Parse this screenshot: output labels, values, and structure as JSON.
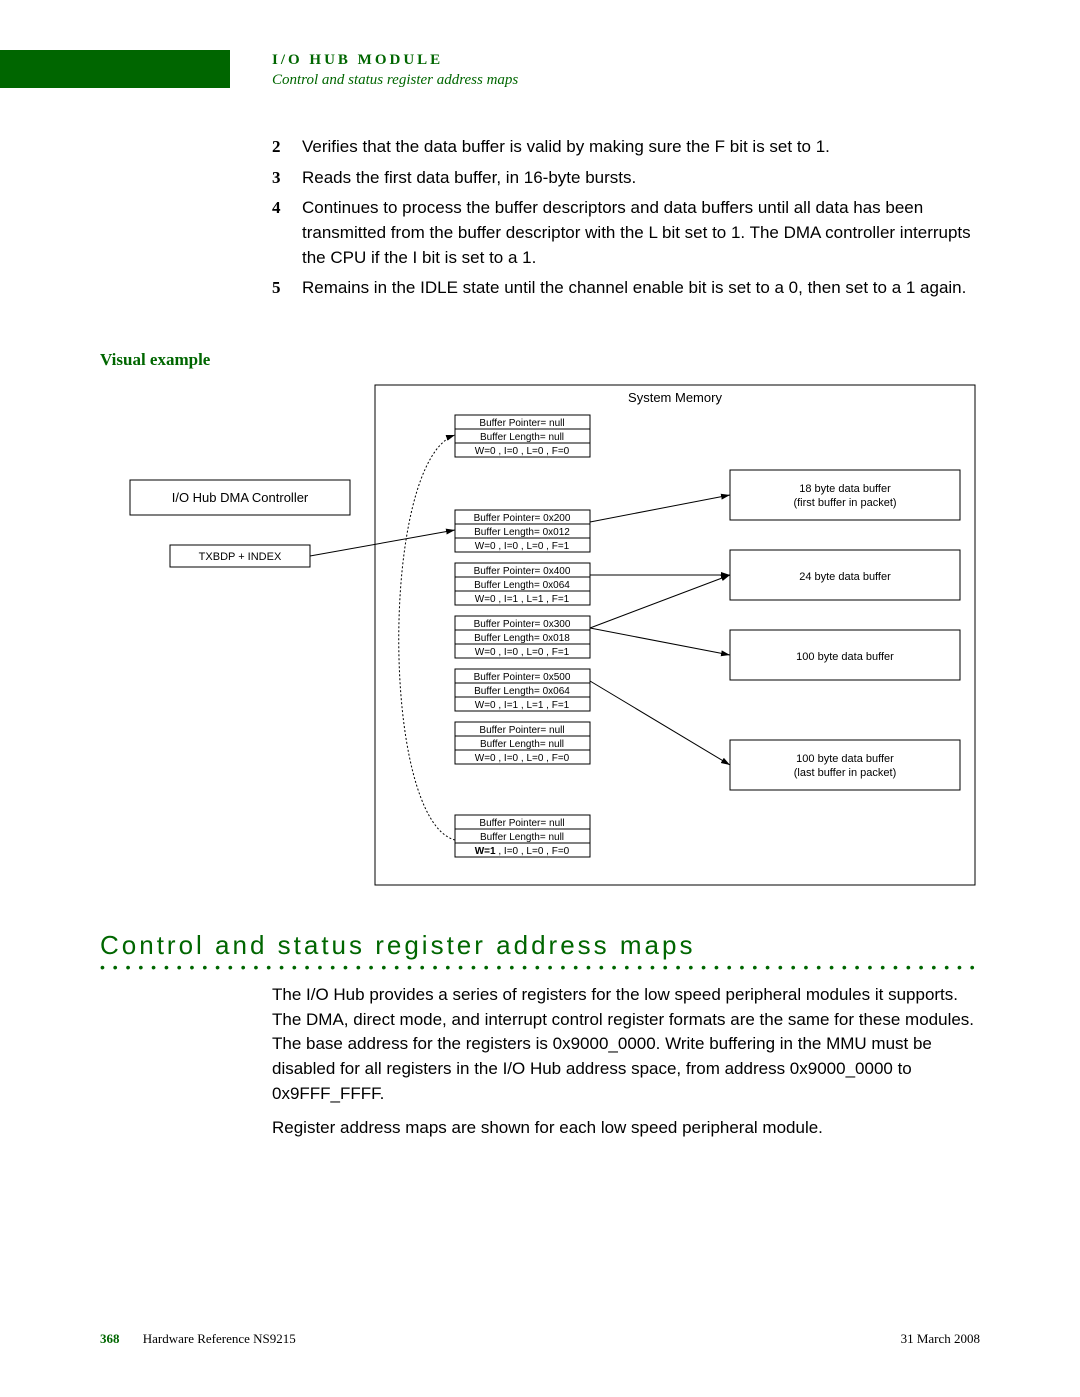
{
  "header": {
    "chapter": "I/O HUB MODULE",
    "subtitle": "Control and status register address maps"
  },
  "steps": [
    {
      "n": "2",
      "t": "Verifies that the data buffer is valid by making sure the F bit is set to 1."
    },
    {
      "n": "3",
      "t": "Reads the first data buffer, in 16-byte bursts."
    },
    {
      "n": "4",
      "t": "Continues to process the buffer descriptors and data buffers until all data has been transmitted from the buffer descriptor with the L bit set to 1. The DMA controller interrupts the CPU if the I bit is set to a 1."
    },
    {
      "n": "5",
      "t": "Remains in the IDLE state until the channel enable bit is set to a 0, then set to a 1 again."
    }
  ],
  "visual_heading": "Visual example",
  "diagram": {
    "sysmem_label": "System Memory",
    "controller_label": "I/O Hub DMA Controller",
    "txbdp_label": "TXBDP + INDEX",
    "descriptors": [
      {
        "bp": "Buffer Pointer= null",
        "bl": "Buffer Length= null",
        "flags": "W=0 , I=0 , L=0 , F=0",
        "wbold": false
      },
      {
        "bp": "Buffer Pointer= 0x200",
        "bl": "Buffer Length= 0x012",
        "flags": "W=0 , I=0 , L=0 , F=1",
        "wbold": false
      },
      {
        "bp": "Buffer Pointer= 0x400",
        "bl": "Buffer Length= 0x064",
        "flags": "W=0 , I=1 , L=1 , F=1",
        "wbold": false
      },
      {
        "bp": "Buffer Pointer= 0x300",
        "bl": "Buffer Length= 0x018",
        "flags": "W=0 , I=0 , L=0 , F=1",
        "wbold": false
      },
      {
        "bp": "Buffer Pointer= 0x500",
        "bl": "Buffer Length= 0x064",
        "flags": "W=0 , I=1 , L=1 , F=1",
        "wbold": false
      },
      {
        "bp": "Buffer Pointer= null",
        "bl": "Buffer Length= null",
        "flags": "W=0 , I=0 , L=0 , F=0",
        "wbold": false
      },
      {
        "bp": "Buffer Pointer= null",
        "bl": "Buffer Length= null",
        "flags": "W=1 , I=0 , L=0 , F=0",
        "wbold": true
      }
    ],
    "buffers": [
      {
        "l1": "18 byte data buffer",
        "l2": "(first buffer in packet)"
      },
      {
        "l1": "24 byte data buffer",
        "l2": ""
      },
      {
        "l1": "100 byte data buffer",
        "l2": ""
      },
      {
        "l1": "100 byte data buffer",
        "l2": "(last buffer in packet)"
      }
    ]
  },
  "section": {
    "title": "Control and status register address maps",
    "p1": "The I/O Hub provides a series of registers for the low speed peripheral modules it supports. The DMA, direct mode, and interrupt control register formats are the same for these modules. The base address for the registers is 0x9000_0000. Write buffering in the MMU must be disabled for all registers in the I/O Hub address space, from address 0x9000_0000 to 0x9FFF_FFFF.",
    "p2": "Register address maps are shown for each low speed peripheral module."
  },
  "footer": {
    "page": "368",
    "doc": "Hardware Reference NS9215",
    "date": "31 March 2008"
  }
}
